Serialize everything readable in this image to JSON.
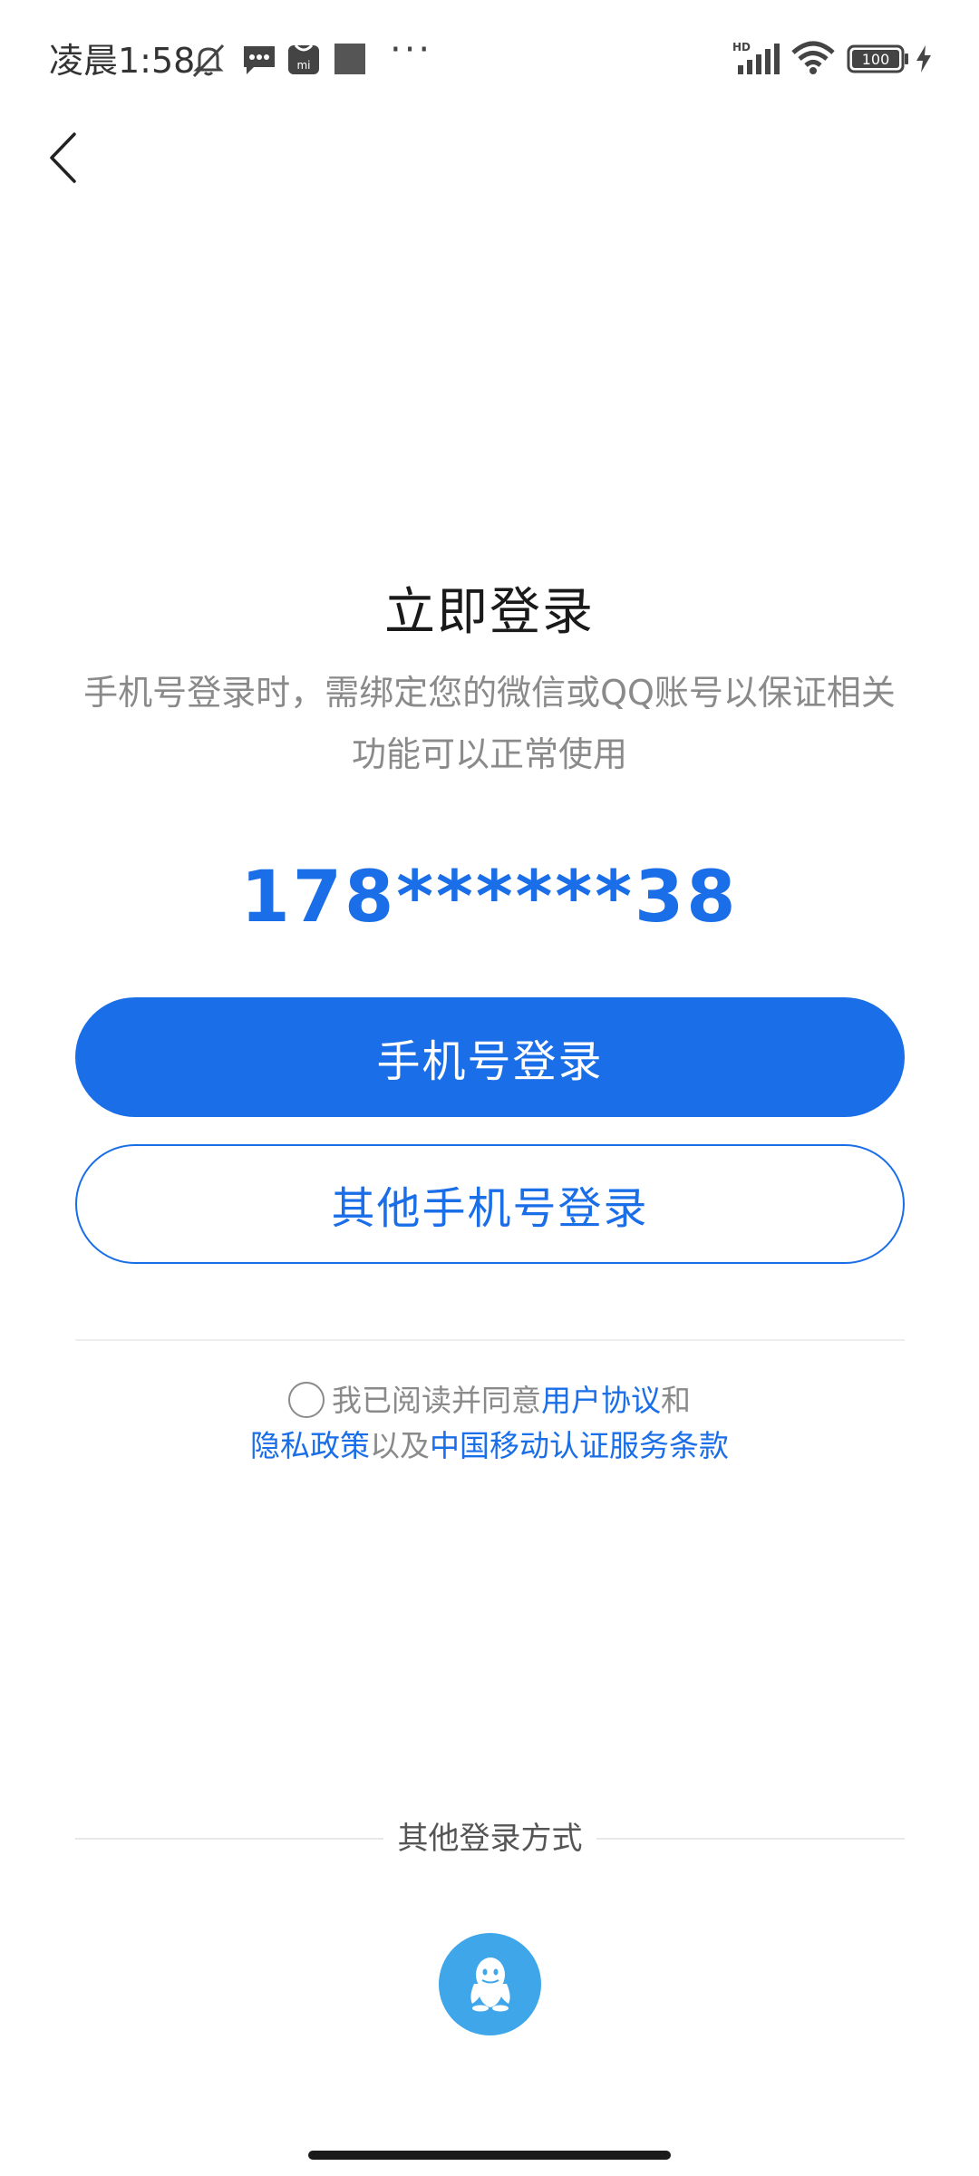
{
  "status_bar": {
    "time": "凌晨1:58",
    "icons": [
      "mute-icon",
      "message-icon",
      "mi-app-icon",
      "square-app-icon",
      "more-icon",
      "hd-signal-icon",
      "wifi-icon",
      "battery-icon",
      "charging-icon"
    ],
    "battery_level": "100",
    "more_dots": "···"
  },
  "header": {
    "back_icon": "chevron-left-icon"
  },
  "login": {
    "title": "立即登录",
    "subtitle": "手机号登录时，需绑定您的微信或QQ账号以保证相关功能可以正常使用",
    "masked_phone": "178******38",
    "primary_button": "手机号登录",
    "secondary_button": "其他手机号登录"
  },
  "agreement": {
    "checked": false,
    "prefix": "我已阅读并同意",
    "user_agreement": "用户协议",
    "and": "和",
    "privacy_policy": "隐私政策",
    "and_also": "以及",
    "cmcc_terms": "中国移动认证服务条款"
  },
  "other_login": {
    "label": "其他登录方式",
    "options": [
      "qq-icon"
    ]
  },
  "colors": {
    "accent": "#1a6ee8",
    "qq_blue": "#3fa6ea",
    "muted_text": "#8a8a8a"
  }
}
